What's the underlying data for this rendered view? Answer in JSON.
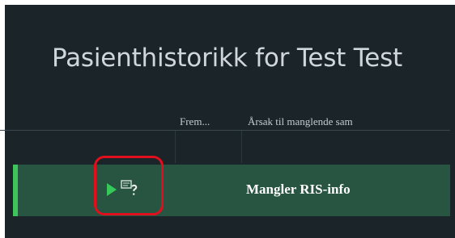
{
  "window": {
    "title": "Pasienthistorikk for Test Test"
  },
  "table": {
    "columns": [
      "Frem...",
      "Årsak til manglende sam"
    ],
    "rows": [
      {
        "reason": "Mangler RIS-info",
        "status_icon": "play-icon",
        "type_icon": "device-question-icon"
      }
    ]
  },
  "colors": {
    "background": "#1b2529",
    "row": "#285541",
    "accent": "#3fc35b",
    "highlight": "#e10f1d"
  }
}
